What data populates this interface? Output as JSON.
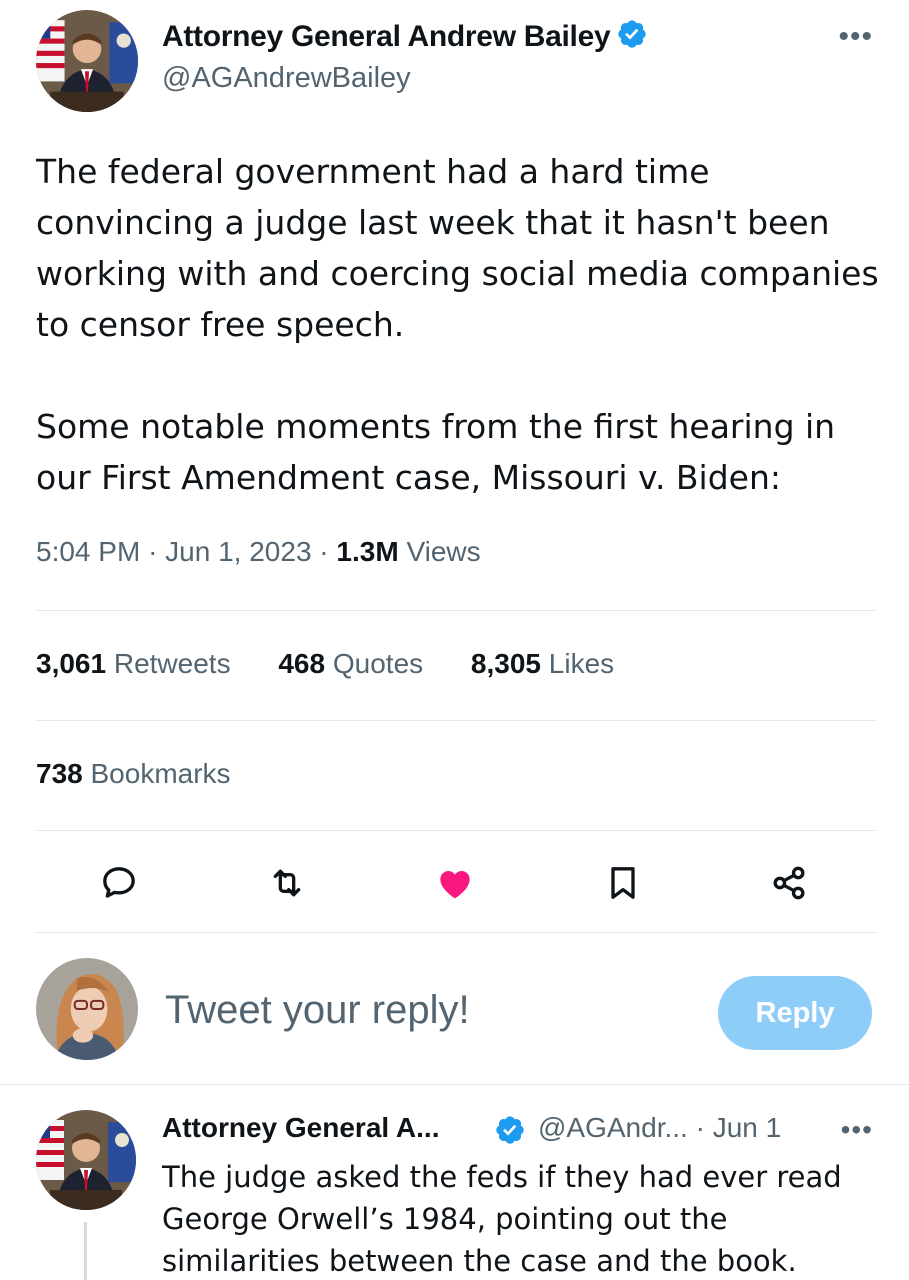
{
  "tweet": {
    "author": {
      "name": "Attorney General Andrew Bailey",
      "handle": "@AGAndrewBailey",
      "verified_color": "#1d9bf0"
    },
    "more_label": "•••",
    "text_paragraphs": [
      "The federal government had a hard time convincing a judge last week that it hasn't been working with and coercing social media companies to censor free speech.",
      "Some notable moments from the first hearing in our First Amendment case, Missouri v. Biden:"
    ],
    "time": "5:04 PM",
    "date": "Jun 1, 2023",
    "separator": "·",
    "views_count": "1.3M",
    "views_label": "Views",
    "stats": {
      "retweets_count": "3,061",
      "retweets_label": "Retweets",
      "quotes_count": "468",
      "quotes_label": "Quotes",
      "likes_count": "8,305",
      "likes_label": "Likes",
      "bookmarks_count": "738",
      "bookmarks_label": "Bookmarks"
    },
    "actions": {
      "reply_icon": "comment-icon",
      "retweet_icon": "retweet-icon",
      "like_icon": "heart-icon",
      "like_color": "#f91880",
      "bookmark_icon": "bookmark-icon",
      "share_icon": "share-icon"
    }
  },
  "composer": {
    "placeholder": "Tweet your reply!",
    "reply_button": "Reply",
    "reply_button_color": "#8ecdf7"
  },
  "reply_tweet": {
    "name": "Attorney General A...",
    "handle": "@AGAndr...",
    "separator": "·",
    "date": "Jun 1",
    "more_label": "•••",
    "text": "The judge asked the feds if they had ever read George Orwell’s 1984, pointing out the similarities between the case and the book."
  }
}
